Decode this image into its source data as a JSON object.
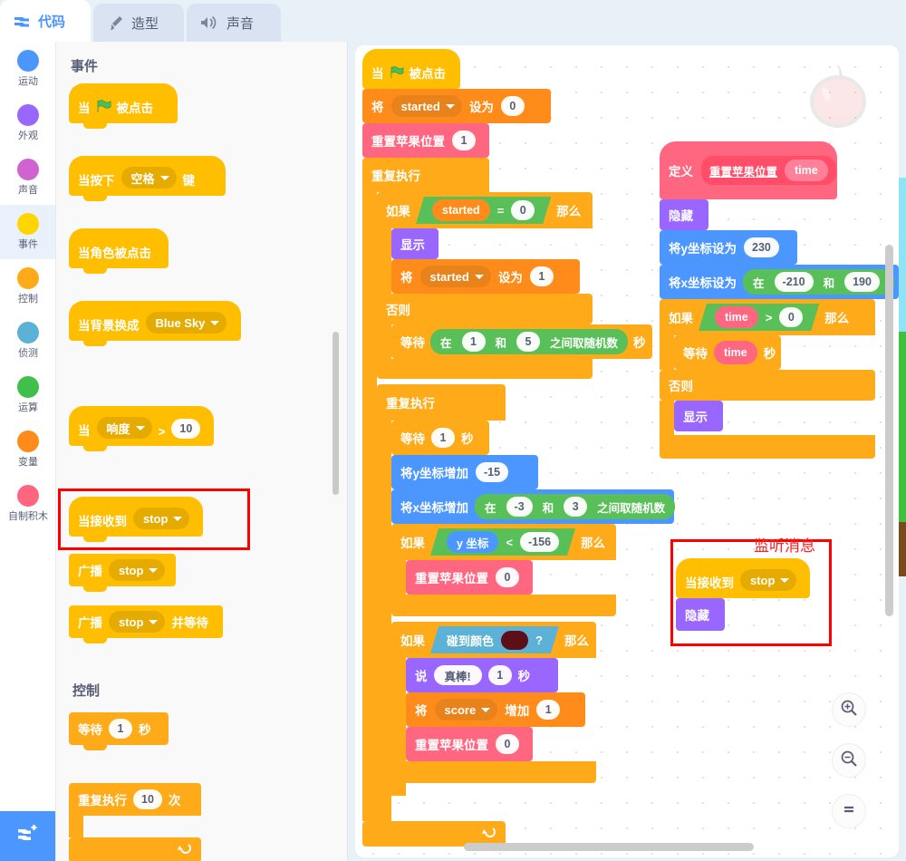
{
  "tabs": [
    {
      "label": "代码",
      "icon": "code-icon",
      "active": true
    },
    {
      "label": "造型",
      "icon": "paintbrush-icon",
      "active": false
    },
    {
      "label": "声音",
      "icon": "speaker-icon",
      "active": false
    }
  ],
  "categories": [
    {
      "label": "运动",
      "color": "#4c97ff",
      "selected": false
    },
    {
      "label": "外观",
      "color": "#9966ff",
      "selected": false
    },
    {
      "label": "声音",
      "color": "#cf63cf",
      "selected": false
    },
    {
      "label": "事件",
      "color": "#ffd500",
      "selected": true
    },
    {
      "label": "控制",
      "color": "#ffab19",
      "selected": false
    },
    {
      "label": "侦测",
      "color": "#5cb1d6",
      "selected": false
    },
    {
      "label": "运算",
      "color": "#40bf4a",
      "selected": false
    },
    {
      "label": "变量",
      "color": "#ff8c1a",
      "selected": false
    },
    {
      "label": "自制积木",
      "color": "#ff6680",
      "selected": false
    }
  ],
  "add_extension": {
    "name": "add-extension-button",
    "label": ""
  },
  "palette": {
    "section_events": "事件",
    "section_control": "控制",
    "blocks": {
      "when_flag": {
        "pre": "当",
        "post": "被点击"
      },
      "when_key": {
        "pre": "当按下",
        "value": "空格",
        "post": "键"
      },
      "when_sprite": {
        "label": "当角色被点击"
      },
      "when_backdrop": {
        "pre": "当背景换成",
        "value": "Blue Sky"
      },
      "when_loudness": {
        "pre": "当",
        "value": "响度",
        "op": ">",
        "num": "10"
      },
      "when_receive": {
        "pre": "当接收到",
        "value": "stop"
      },
      "broadcast": {
        "pre": "广播",
        "value": "stop"
      },
      "broadcast_wait": {
        "pre": "广播",
        "value": "stop",
        "post": "并等待"
      },
      "wait_secs": {
        "pre": "等待",
        "num": "1",
        "post": "秒"
      },
      "repeat_times": {
        "pre": "重复执行",
        "num": "10",
        "post": "次"
      }
    }
  },
  "workspace": {
    "script_main": {
      "hat": {
        "pre": "当",
        "post": "被点击"
      },
      "set_started_0": {
        "pre": "将",
        "var": "started",
        "mid": "设为",
        "num": "0"
      },
      "reset_apple_1": {
        "label": "重置苹果位置",
        "num": "1"
      },
      "forever_1": {
        "label": "重复执行"
      },
      "if_started_eq0": {
        "pre": "如果",
        "left": "started",
        "op": "=",
        "right": "0",
        "post": "那么"
      },
      "show": {
        "label": "显示"
      },
      "set_started_1": {
        "pre": "将",
        "var": "started",
        "mid": "设为",
        "num": "1"
      },
      "else": {
        "label": "否则"
      },
      "wait_random": {
        "pre": "等待",
        "rpre": "在",
        "rmin": "1",
        "rand": "和",
        "rmax": "5",
        "rpost": "之间取随机数",
        "post": "秒"
      },
      "forever_2": {
        "label": "重复执行"
      },
      "wait_1": {
        "pre": "等待",
        "num": "1",
        "post": "秒"
      },
      "change_y": {
        "pre": "将y坐标增加",
        "num": "-15"
      },
      "change_x": {
        "pre": "将x坐标增加",
        "rpre": "在",
        "rmin": "-3",
        "rand": "和",
        "rmax": "3",
        "rpost": "之间取随机数"
      },
      "if_y_lt": {
        "pre": "如果",
        "left": "y 坐标",
        "op": "<",
        "right": "-156",
        "post": "那么"
      },
      "reset_apple_0a": {
        "label": "重置苹果位置",
        "num": "0"
      },
      "if_touch_color": {
        "pre": "如果",
        "label": "碰到颜色",
        "color": "#5c0f16",
        "q": "?",
        "post": "那么"
      },
      "say": {
        "pre": "说",
        "text": "真棒!",
        "num": "1",
        "post": "秒"
      },
      "change_score": {
        "pre": "将",
        "var": "score",
        "mid": "增加",
        "num": "1"
      },
      "reset_apple_0b": {
        "label": "重置苹果位置",
        "num": "0"
      }
    },
    "script_define": {
      "define": {
        "pre": "定义",
        "name": "重置苹果位置",
        "param": "time"
      },
      "hide": {
        "label": "隐藏"
      },
      "set_y": {
        "pre": "将y坐标设为",
        "num": "230"
      },
      "set_x": {
        "pre": "将x坐标设为",
        "rpre": "在",
        "rmin": "-210",
        "rand": "和",
        "rmax": "190"
      },
      "if_time_gt0": {
        "pre": "如果",
        "left": "time",
        "op": ">",
        "right": "0",
        "post": "那么"
      },
      "wait_time": {
        "pre": "等待",
        "param": "time",
        "post": "秒"
      },
      "else": {
        "label": "否则"
      },
      "show": {
        "label": "显示"
      }
    },
    "script_receive": {
      "when_receive": {
        "pre": "当接收到",
        "value": "stop"
      },
      "hide": {
        "label": "隐藏"
      }
    },
    "annotations": {
      "listen_message": "监听消息"
    },
    "zoom_controls": {
      "zoom_in": "zoom-in-icon",
      "zoom_out": "zoom-out-icon",
      "zoom_reset": "zoom-reset-icon"
    },
    "watermark": "apple-sprite-watermark"
  }
}
